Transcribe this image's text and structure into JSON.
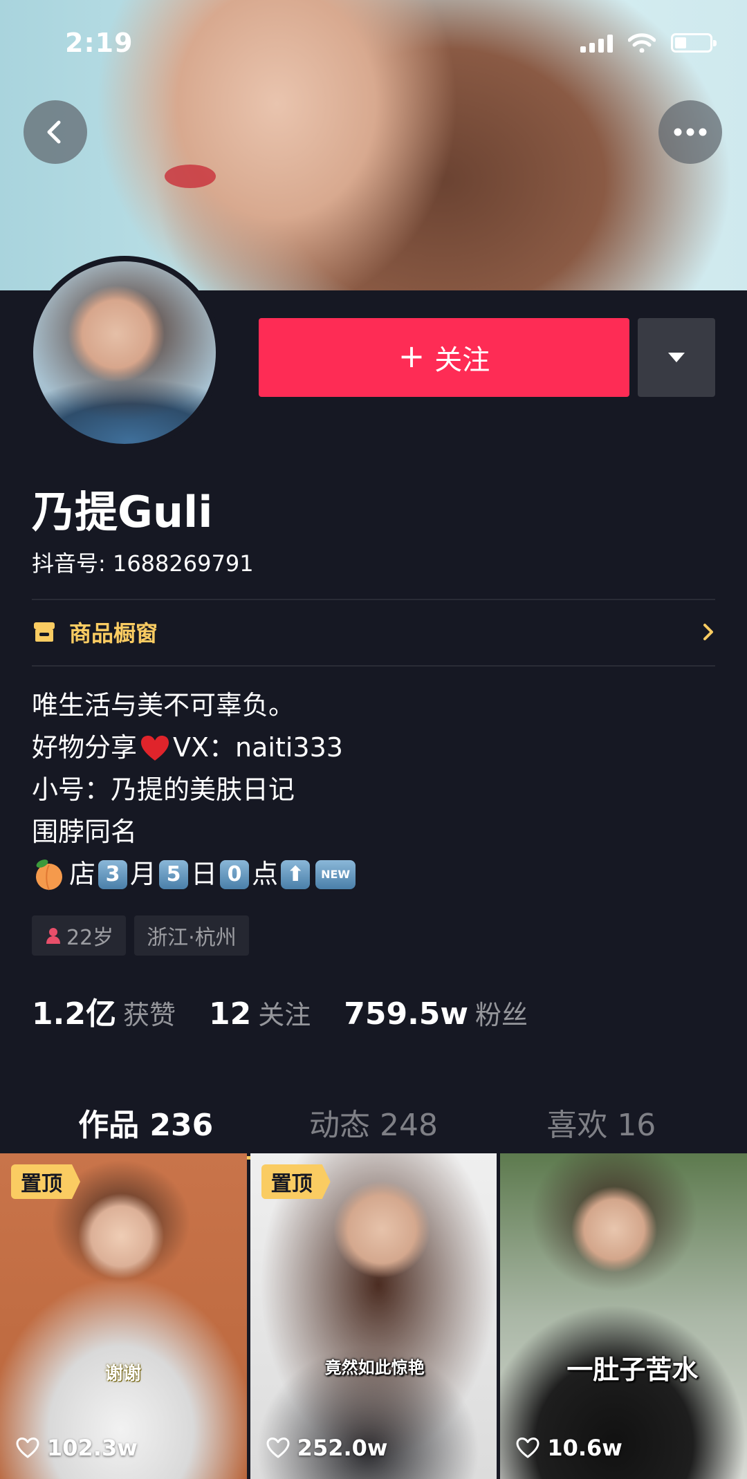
{
  "status_bar": {
    "time": "2:19"
  },
  "header": {
    "follow_label": "关注",
    "follow_plus": "+"
  },
  "profile": {
    "name": "乃提Guli",
    "douyin_id": "抖音号: 1688269791",
    "shop_label": "商品橱窗",
    "bio": {
      "line1": "唯生活与美不可辜负。",
      "line2_prefix": "好物分享",
      "line2_suffix": "VX：naiti333",
      "line3": "小号：乃提的美肤日记",
      "line4": "围脖同名",
      "line5": {
        "store": "店",
        "month_num": "3",
        "month": "月",
        "day_num": "5",
        "day": "日",
        "hour_num": "0",
        "hour": "点",
        "new_badge": "NEW"
      }
    },
    "tags": {
      "age": "22岁",
      "location": "浙江·杭州"
    },
    "stats": [
      {
        "num": "1.2亿",
        "label": "获赞"
      },
      {
        "num": "12",
        "label": "关注"
      },
      {
        "num": "759.5w",
        "label": "粉丝"
      }
    ]
  },
  "tabs": [
    {
      "label": "作品 236",
      "active": true
    },
    {
      "label": "动态 248",
      "active": false
    },
    {
      "label": "喜欢 16",
      "active": false
    }
  ],
  "videos": [
    {
      "pinned": "置顶",
      "caption": "谢谢",
      "likes": "102.3w"
    },
    {
      "pinned": "置顶",
      "caption": "竟然如此惊艳",
      "likes": "252.0w"
    },
    {
      "pinned": "",
      "caption": "一肚子苦水",
      "likes": "10.6w"
    }
  ],
  "colors": {
    "background": "#161823",
    "accent_red": "#fe2c55",
    "accent_yellow": "#facc62"
  },
  "icons": [
    "back-icon",
    "more-icon",
    "dropdown-icon",
    "shop-icon",
    "chevron-right-icon",
    "heart-icon",
    "female-icon",
    "signal-icon",
    "wifi-icon",
    "battery-icon"
  ]
}
